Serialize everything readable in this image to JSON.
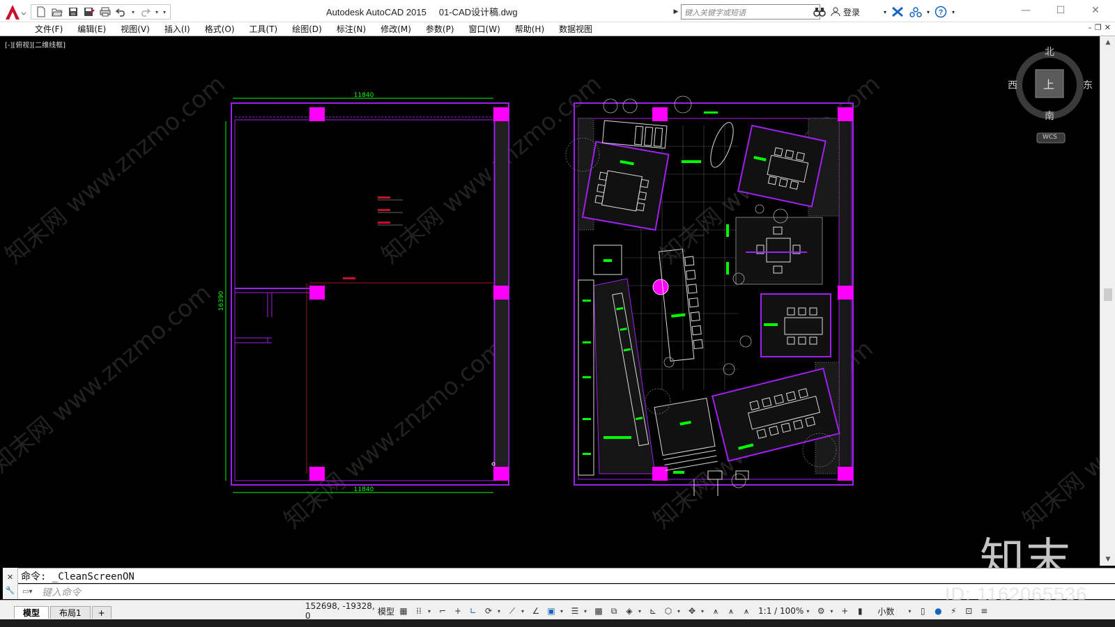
{
  "window": {
    "app_name": "Autodesk AutoCAD 2015",
    "file_name": "01-CAD设计稿.dwg"
  },
  "search": {
    "placeholder": "键入关键字或短语"
  },
  "account": {
    "login_label": "登录"
  },
  "menu": {
    "items": [
      "文件(F)",
      "编辑(E)",
      "视图(V)",
      "插入(I)",
      "格式(O)",
      "工具(T)",
      "绘图(D)",
      "标注(N)",
      "修改(M)",
      "参数(P)",
      "窗口(W)",
      "帮助(H)",
      "数据视图"
    ]
  },
  "viewport": {
    "label": "[-][俯视][二维线框]"
  },
  "drawing": {
    "plan_left": {
      "dim_top": "11840",
      "dim_bottom": "11840",
      "dim_left": "16390"
    }
  },
  "viewcube": {
    "north": "北",
    "south": "南",
    "west": "西",
    "east": "东",
    "face": "上",
    "wcs": "WCS"
  },
  "command": {
    "history_line": "命令: _CleanScreenON",
    "input_placeholder": "键入命令"
  },
  "layouts": {
    "tabs": [
      "模型",
      "布局1"
    ],
    "active": "模型",
    "add_symbol": "+"
  },
  "status": {
    "coordinates": "152698, -19328, 0",
    "space": "模型",
    "annotation_scale": "1:1 / 100%",
    "units": "小数"
  },
  "watermark": {
    "brand": "知末",
    "id_text": "ID: 1162065536",
    "site_text": "知末网 www.znzmo.com"
  },
  "colors": {
    "magenta": "#c000ff",
    "column": "#ff00ff",
    "green": "#00ff00",
    "autocad_red": "#c8102e"
  }
}
